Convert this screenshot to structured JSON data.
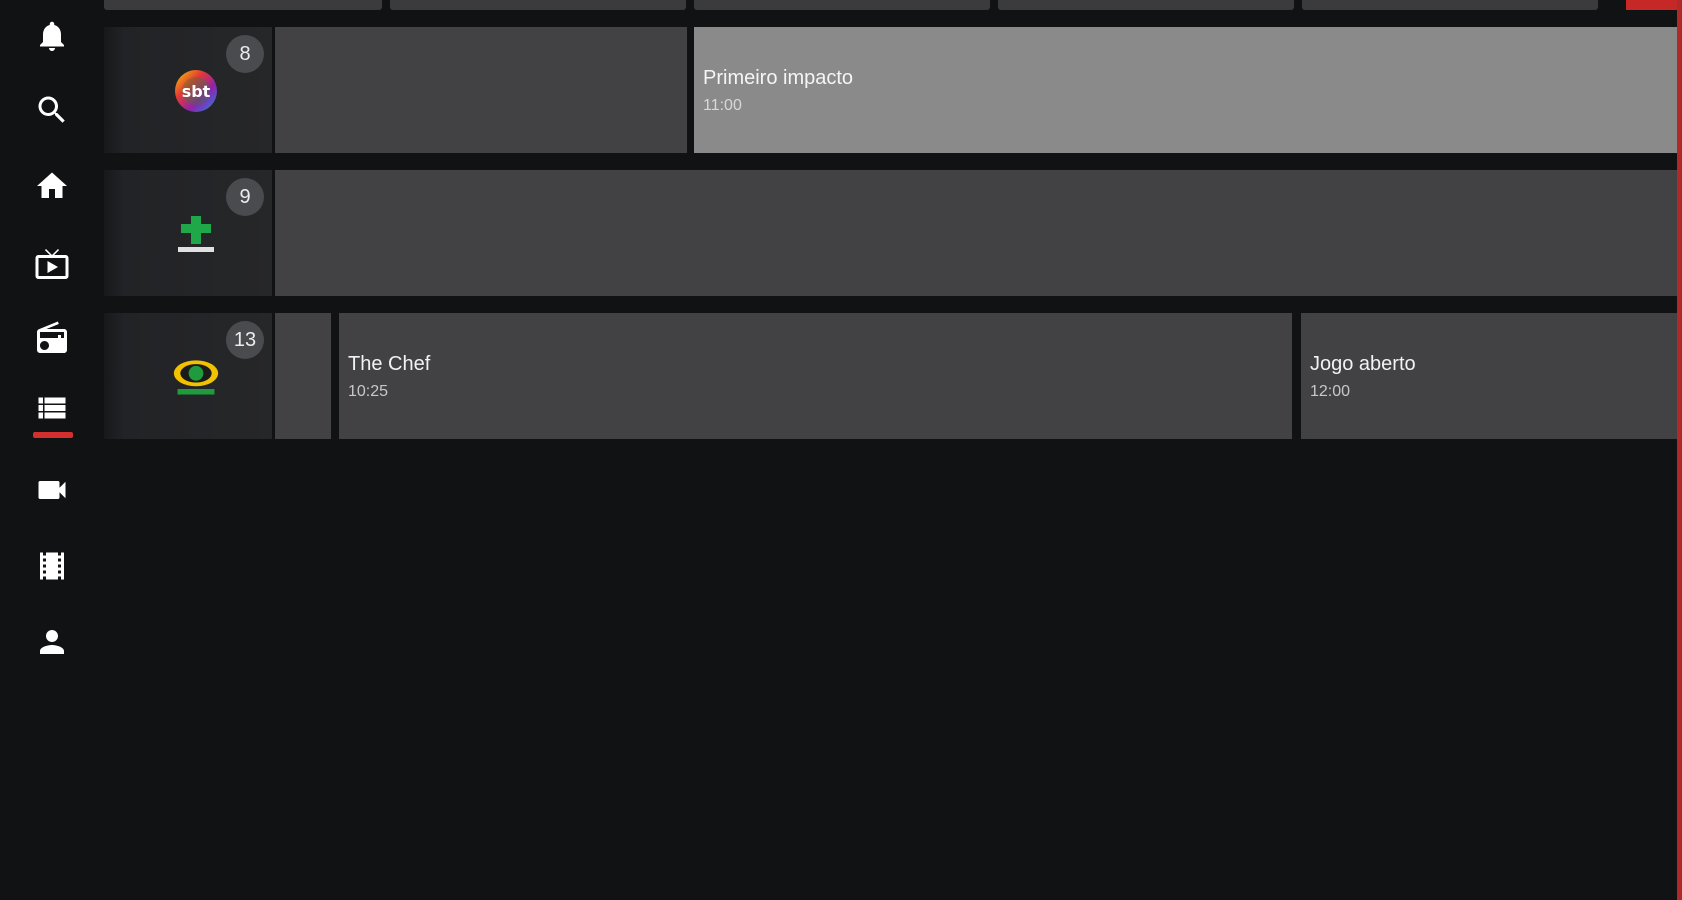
{
  "sidebar": {
    "items": [
      {
        "icon": "bell-icon",
        "label": "Notificações"
      },
      {
        "icon": "search-icon",
        "label": "Buscar"
      },
      {
        "icon": "home-icon",
        "label": "Início"
      },
      {
        "icon": "live-tv-icon",
        "label": "TV ao vivo"
      },
      {
        "icon": "radio-icon",
        "label": "Rádio"
      },
      {
        "icon": "guide-list-icon",
        "label": "Guia"
      },
      {
        "icon": "video-camera-icon",
        "label": "Câmeras"
      },
      {
        "icon": "movie-film-icon",
        "label": "Filmes"
      },
      {
        "icon": "account-icon",
        "label": "Perfil"
      }
    ],
    "active_item": "guide-list-icon",
    "accent_color": "#d32f2f"
  },
  "guide": {
    "channels": [
      {
        "number": "8",
        "logo": "sbt-logo",
        "programs": [
          {
            "title": "",
            "time": ""
          },
          {
            "title": "Primeiro impacto",
            "time": "11:00",
            "focused": true
          }
        ]
      },
      {
        "number": "9",
        "logo": "cultura-logo",
        "programs": [
          {
            "title": "",
            "time": ""
          }
        ]
      },
      {
        "number": "13",
        "logo": "band-logo",
        "programs": [
          {
            "title": "",
            "time": ""
          },
          {
            "title": "The Chef",
            "time": "10:25"
          },
          {
            "title": "Jogo aberto",
            "time": "12:00"
          }
        ]
      }
    ]
  },
  "colors": {
    "background": "#111214",
    "program_cell": "#424244",
    "focused_cell": "#8a8a8a",
    "channel_cell": "#262729",
    "accent": "#d32f2f"
  }
}
